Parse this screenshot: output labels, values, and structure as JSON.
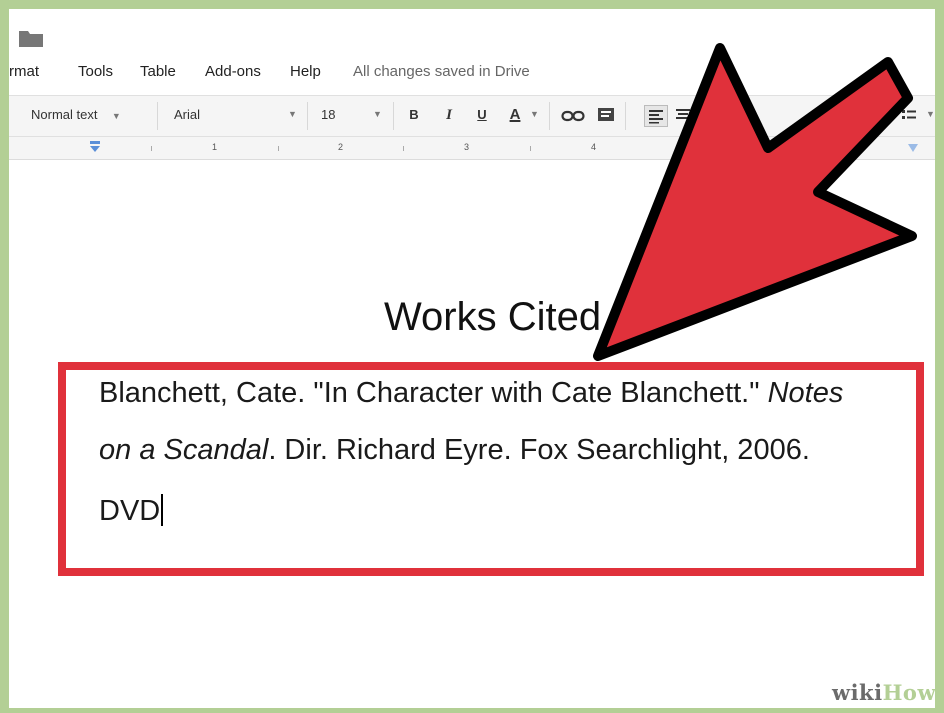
{
  "app": {
    "menu": [
      "rmat",
      "Tools",
      "Table",
      "Add-ons",
      "Help"
    ],
    "save_status": "All changes saved in Drive"
  },
  "toolbar": {
    "style": "Normal text",
    "font": "Arial",
    "size": "18",
    "bold": "B",
    "italic": "I",
    "underline": "U",
    "text_color": "A"
  },
  "ruler": {
    "numbers": [
      "1",
      "2",
      "3",
      "4"
    ]
  },
  "document": {
    "title": "Works Cited",
    "citation": {
      "line1_text": "Blanchett, Cate. \"In Character with Cate Blanchett.\" ",
      "line1_italic": "Notes",
      "line2_italic": "on a Scandal",
      "line2_text": ". Dir. Richard Eyre. Fox Searchlight, 2006.",
      "line3_text": "DVD"
    }
  },
  "annotation": {
    "color": "#e0313b"
  },
  "watermark": {
    "part1": "wiki",
    "part2": "How"
  }
}
